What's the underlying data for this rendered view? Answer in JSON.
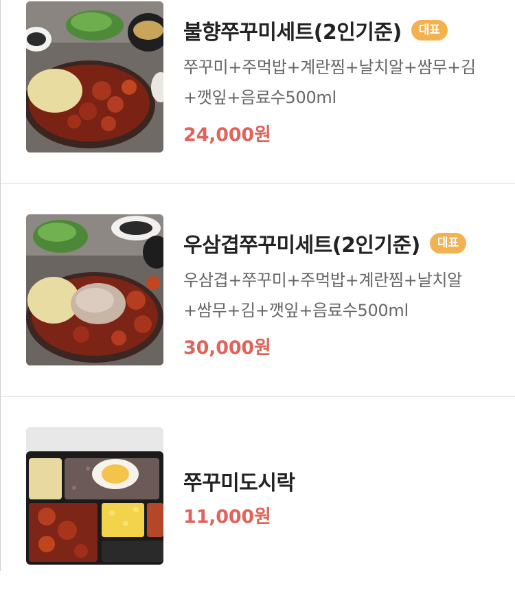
{
  "menu": {
    "items": [
      {
        "name": "불향쭈꾸미세트(2인기준)",
        "badge": "대표",
        "description": "쭈꾸미+주먹밥+계란찜+날치알+쌈무+김+깻잎+음료수500ml",
        "price": "24,000원",
        "image": "jjukkumi-set-photo"
      },
      {
        "name": "우삼겹쭈꾸미세트(2인기준)",
        "badge": "대표",
        "description": "우삼겹+쭈꾸미+주먹밥+계란찜+날치알+쌈무+김+깻잎+음료수500ml",
        "price": "30,000원",
        "image": "usamgyeop-jjukkumi-set-photo"
      },
      {
        "name": "쭈꾸미도시락",
        "price": "11,000원",
        "image": "jjukkumi-dosirak-photo"
      }
    ]
  },
  "colors": {
    "badge": "#f4b14f",
    "price": "#e0645a",
    "title": "#222222",
    "description": "#666666",
    "divider": "#ececec"
  }
}
